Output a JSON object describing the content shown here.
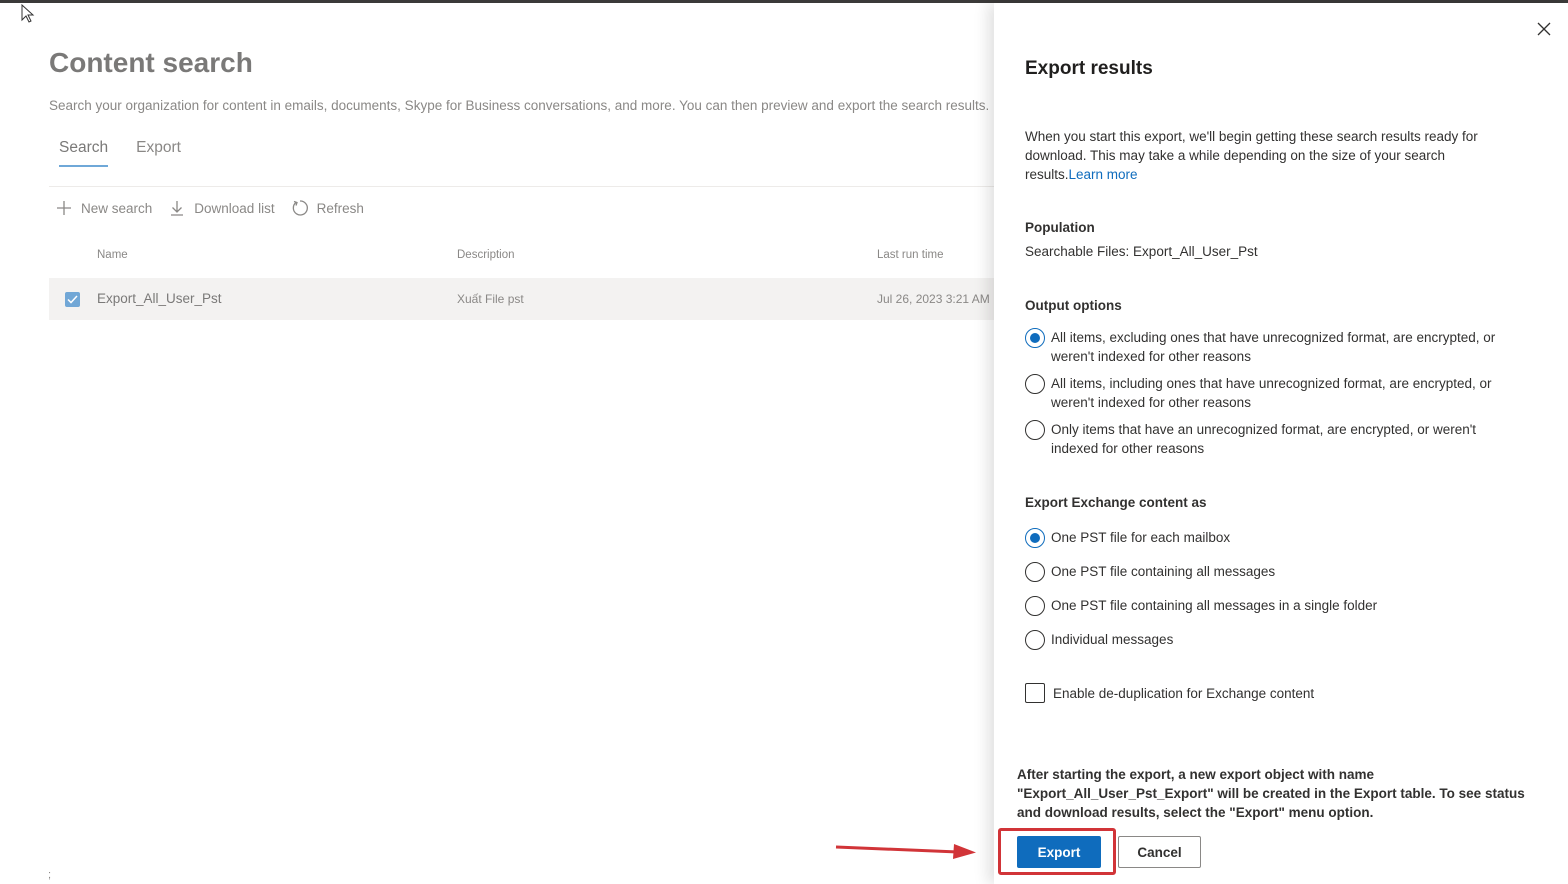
{
  "background": {
    "title": "Content search",
    "description": "Search your organization for content in emails, documents, Skype for Business conversations, and more. You can then preview and export the search results.",
    "tabs": [
      {
        "label": "Search",
        "active": true
      },
      {
        "label": "Export",
        "active": false
      }
    ],
    "toolbar": {
      "new_search": "New search",
      "download_list": "Download list",
      "refresh": "Refresh"
    },
    "columns": {
      "name": "Name",
      "description": "Description",
      "last_run": "Last run time"
    },
    "rows": [
      {
        "name": "Export_All_User_Pst",
        "description": "Xuất File pst",
        "last_run": "Jul 26, 2023 3:21 AM",
        "selected": true
      }
    ],
    "footer_mark": ";"
  },
  "panel": {
    "title": "Export results",
    "intro": "When you start this export, we'll begin getting these search results ready for download. This may take a while depending on the size of your search results.",
    "learn_more": "Learn more",
    "population_label": "Population",
    "population_value": "Searchable Files: Export_All_User_Pst",
    "output_label": "Output options",
    "output_options": [
      {
        "label": "All items, excluding ones that have unrecognized format, are encrypted, or weren't indexed for other reasons",
        "selected": true
      },
      {
        "label": "All items, including ones that have unrecognized format, are encrypted, or weren't indexed for other reasons",
        "selected": false
      },
      {
        "label": "Only items that have an unrecognized format, are encrypted, or weren't indexed for other reasons",
        "selected": false
      }
    ],
    "exchange_label": "Export Exchange content as",
    "exchange_options": [
      {
        "label": "One PST file for each mailbox",
        "selected": true
      },
      {
        "label": "One PST file containing all messages",
        "selected": false
      },
      {
        "label": "One PST file containing all messages in a single folder",
        "selected": false
      },
      {
        "label": "Individual messages",
        "selected": false
      }
    ],
    "dedup_label": "Enable de-duplication for Exchange content",
    "dedup_checked": false,
    "footer_note": "After starting the export, a new export object with name \"Export_All_User_Pst_Export\" will be created in the Export table. To see status and download results, select the \"Export\" menu option.",
    "export_button": "Export",
    "cancel_button": "Cancel"
  },
  "colors": {
    "primary": "#0f6cbd",
    "annotation": "#d13438"
  }
}
